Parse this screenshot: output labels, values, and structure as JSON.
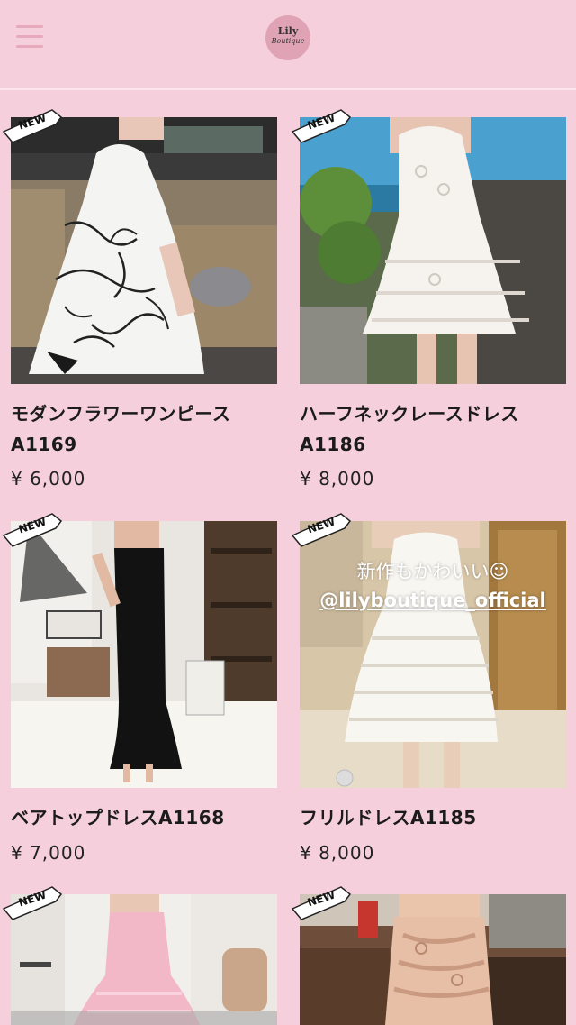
{
  "header": {
    "menu_icon": "hamburger-menu-icon",
    "logo": {
      "line1": "Lily",
      "line2": "Boutique"
    }
  },
  "badge_label": "NEW",
  "products": [
    {
      "name_line1": "モダンフラワーワンピース",
      "name_line2": "A1169",
      "price": "¥ 6,000"
    },
    {
      "name_line1": "ハーフネックレースドレス",
      "name_line2": "A1186",
      "price": "¥ 8,000"
    },
    {
      "name_line1": "ベアトップドレスA1168",
      "name_line2": "",
      "price": "¥ 7,000"
    },
    {
      "name_line1": "フリルドレスA1185",
      "name_line2": "",
      "price": "¥ 8,000"
    },
    {
      "name_line1": "",
      "name_line2": "",
      "price": ""
    },
    {
      "name_line1": "",
      "name_line2": "",
      "price": ""
    }
  ],
  "photo_overlay": {
    "line1": "新作もかわいい☺",
    "line2": "@lilyboutique_official"
  },
  "colors": {
    "background": "#f5cfdb",
    "logo_circle": "#e0a3b6",
    "menu_icon": "#e7a9bc"
  }
}
